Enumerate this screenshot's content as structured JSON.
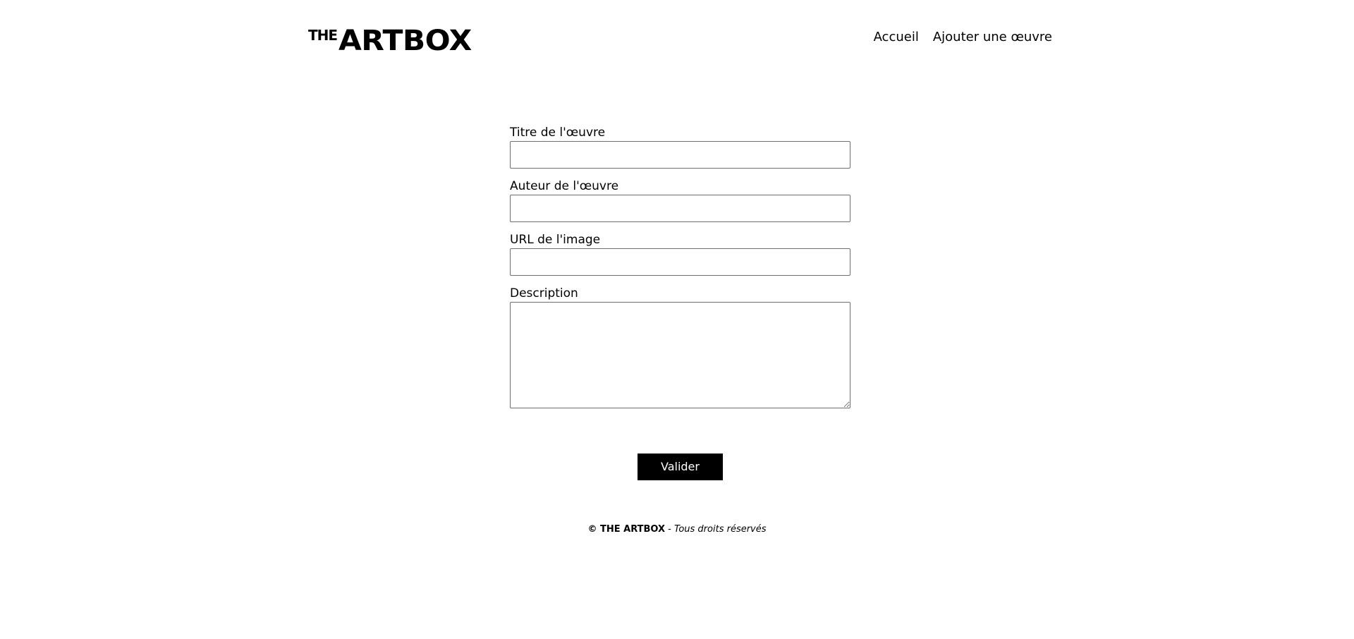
{
  "header": {
    "logo": {
      "small": "THE",
      "large": "ARTBOX"
    },
    "nav": [
      {
        "label": "Accueil"
      },
      {
        "label": "Ajouter une œuvre"
      }
    ]
  },
  "form": {
    "fields": [
      {
        "label": "Titre de l'œuvre",
        "value": ""
      },
      {
        "label": "Auteur de l'œuvre",
        "value": ""
      },
      {
        "label": "URL de l'image",
        "value": ""
      },
      {
        "label": "Description",
        "value": ""
      }
    ],
    "submit_label": "Valider"
  },
  "footer": {
    "brand": "© THE ARTBOX",
    "separator": " - ",
    "rights": "Tous droits réservés"
  }
}
